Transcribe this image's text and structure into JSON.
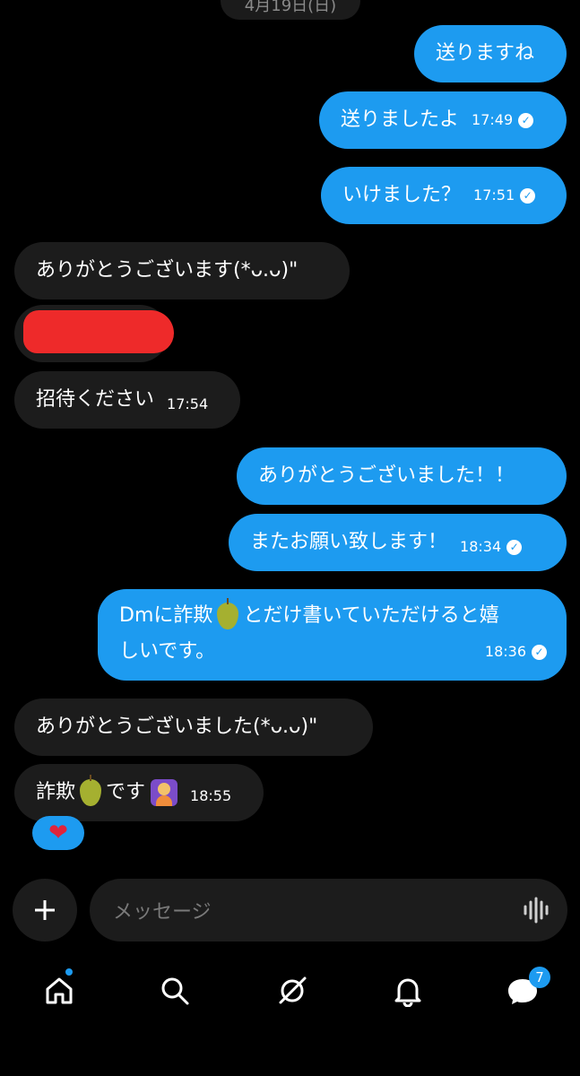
{
  "date": "4月19日(日)",
  "messages": [
    {
      "text": "送りますね",
      "time": ""
    },
    {
      "text": "送りましたよ",
      "time": "17:49"
    },
    {
      "text": "いけました？",
      "time": "17:51"
    },
    {
      "text": "ありがとうございます(*ᴗ.ᴗ)\"",
      "time": ""
    },
    {
      "text": "招待ください",
      "time": "17:54"
    },
    {
      "text": "ありがとうございました！！",
      "time": ""
    },
    {
      "text": "またお願い致します！",
      "time": "18:34"
    },
    {
      "text_a": "Dmに詐欺",
      "text_b": "とだけ書いていただけると嬉",
      "text_c": "しいです。",
      "time": "18:36"
    },
    {
      "text": "ありがとうございました(*ᴗ.ᴗ)\"",
      "time": ""
    },
    {
      "text_a": "詐欺",
      "text_b": "です",
      "time": "18:55"
    }
  ],
  "reaction": "❤",
  "composer": {
    "placeholder": "メッセージ"
  },
  "nav": {
    "badge_count": "7"
  },
  "colors": {
    "accent": "#1d9bf0",
    "incoming": "#1c1c1c",
    "background": "#000000"
  }
}
